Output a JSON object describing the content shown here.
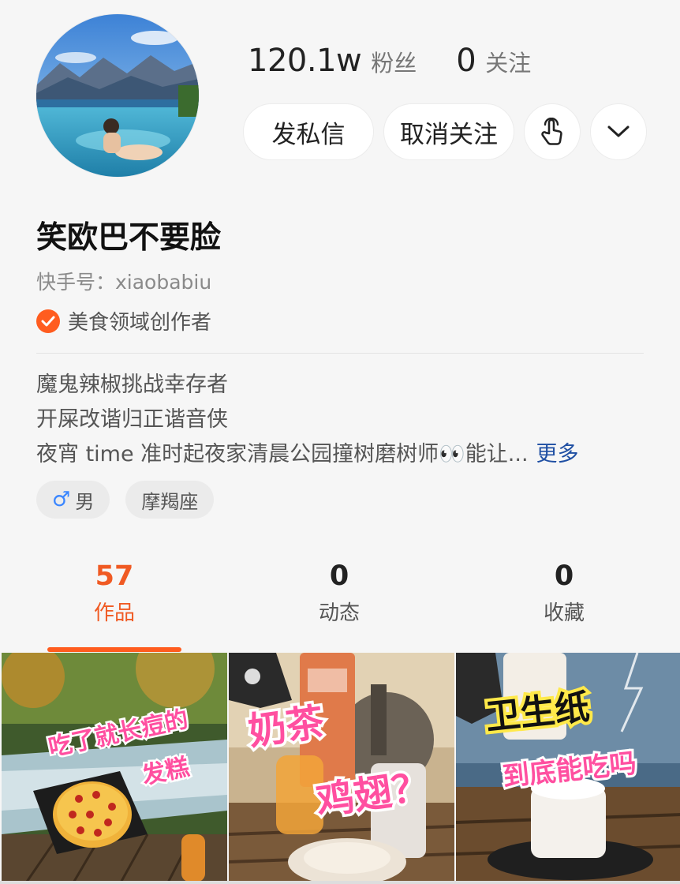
{
  "profile": {
    "name": "笑欧巴不要脸",
    "kuaishou_id": "快手号：xiaobabiu",
    "certification": "美食领域创作者",
    "stats": {
      "fans_value": "120.1w",
      "fans_label": "粉丝",
      "following_value": "0",
      "following_label": "关注"
    },
    "bio": {
      "line1": "魔鬼辣椒挑战幸存者",
      "line2": "开屎改谐归正谐音侠",
      "line3": "夜宵 time 准时起夜家清晨公园撞树磨树师👀能让...",
      "more": "更多"
    },
    "tags": {
      "gender_icon": "♂",
      "gender": "男",
      "zodiac": "摩羯座"
    }
  },
  "actions": {
    "message": "发私信",
    "unfollow": "取消关注",
    "icons": [
      "touch-hand-icon",
      "chevron-down-icon"
    ]
  },
  "tabs": [
    {
      "count": "57",
      "label": "作品",
      "active": true
    },
    {
      "count": "0",
      "label": "动态",
      "active": false
    },
    {
      "count": "0",
      "label": "收藏",
      "active": false
    }
  ],
  "videos": [
    {
      "caption1": "吃了就长痘的",
      "caption2": "发糕"
    },
    {
      "caption1": "奶茶",
      "caption2": "鸡翅？"
    },
    {
      "caption1": "卫生纸",
      "caption2": "到底能吃吗"
    }
  ],
  "colors": {
    "accent": "#ff5c1f",
    "link": "#1f4fa3",
    "background": "#f6f6f6"
  }
}
